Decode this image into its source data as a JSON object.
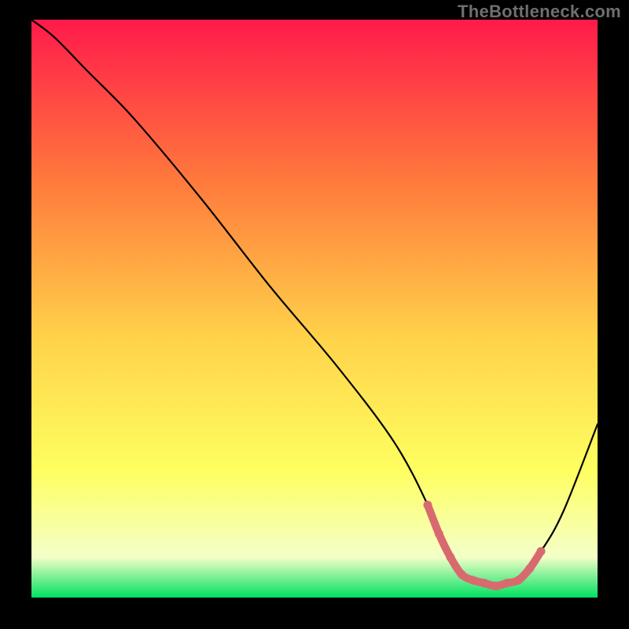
{
  "watermark": "TheBottleneck.com",
  "chart_data": {
    "type": "line",
    "title": "",
    "xlabel": "",
    "ylabel": "",
    "xlim": [
      0,
      100
    ],
    "ylim": [
      0,
      100
    ],
    "grid": false,
    "legend": false,
    "gradient": {
      "top_color": "#ff1a4b",
      "mid_top_color": "#ff7a3c",
      "mid_color": "#ffd24a",
      "mid_low_color": "#feff60",
      "low_color": "#f4ffc8",
      "bottom_color": "#00e060"
    },
    "series": [
      {
        "name": "curve",
        "stroke": "#000000",
        "x": [
          0,
          4,
          10,
          18,
          30,
          42,
          54,
          64,
          70,
          73,
          77,
          82,
          86,
          90,
          94,
          100
        ],
        "values": [
          100,
          97,
          91,
          83,
          69,
          54,
          40,
          27,
          16,
          8,
          3,
          2,
          3,
          8,
          15,
          30
        ]
      }
    ],
    "highlight": {
      "name": "optimal-band",
      "stroke": "#d86a6f",
      "marker_radius": 5.5,
      "x": [
        70,
        72,
        74,
        76,
        78,
        80,
        82,
        84,
        86,
        88,
        90
      ],
      "values": [
        16,
        11,
        7,
        4,
        3,
        2.5,
        2,
        2.5,
        3,
        5,
        8
      ]
    }
  }
}
